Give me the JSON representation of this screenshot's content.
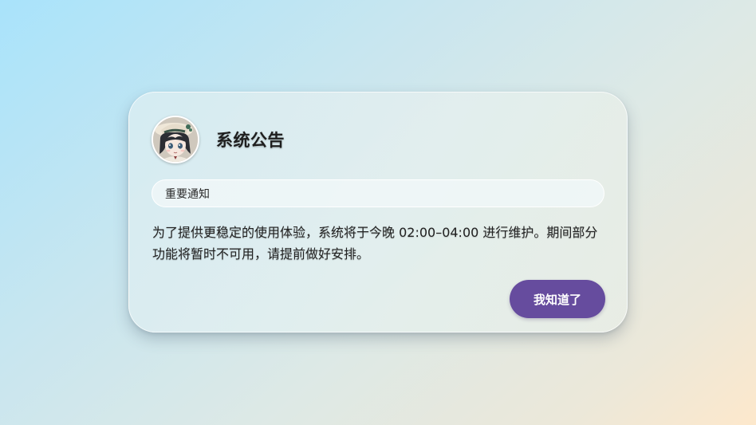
{
  "dialog": {
    "title": "系统公告",
    "avatar_icon": "anime-girl-avatar-icon",
    "badge": "重要通知",
    "message": "为了提供更稳定的使用体验，系统将于今晚 02:00–04:00 进行维护。期间部分功能将暂时不可用，请提前做好安排。",
    "confirm_label": "我知道了"
  },
  "colors": {
    "accent": "#664c9e",
    "title_text": "#1e1e1e"
  }
}
